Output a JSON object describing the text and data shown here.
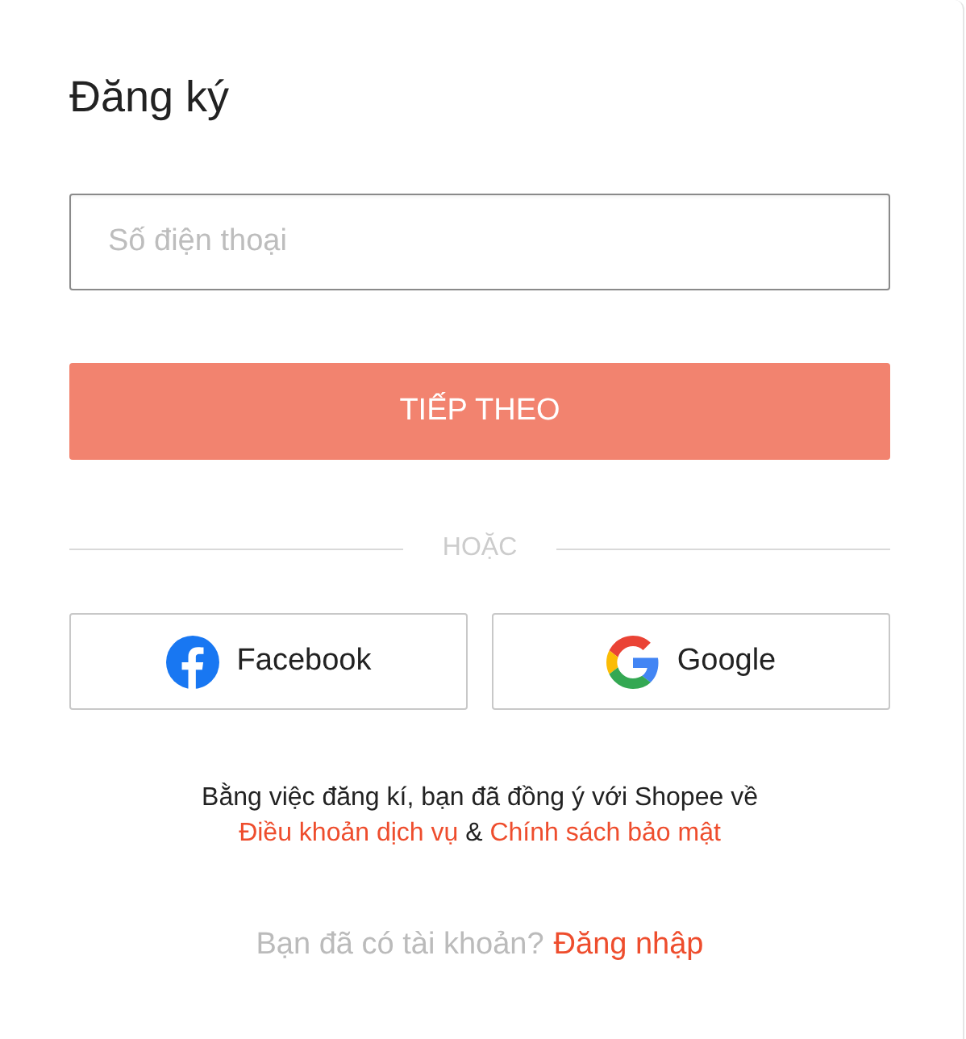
{
  "title": "Đăng ký",
  "phone_field": {
    "placeholder": "Số điện thoại"
  },
  "next_button": {
    "label": "TIẾP THEO",
    "disabled": true
  },
  "divider_label": "HOẶC",
  "social_buttons": [
    {
      "kind": "facebook",
      "label": "Facebook"
    },
    {
      "kind": "google",
      "label": "Google"
    }
  ],
  "terms": {
    "text": "Bằng việc đăng kí, bạn đã đồng ý với Shopee về",
    "link_1": "Điều khoản dịch vụ",
    "separator": "&",
    "link_2": "Chính sách bảo mật"
  },
  "login_prompt": {
    "text": "Bạn đã có tài khoản?",
    "link": "Đăng nhập"
  }
}
